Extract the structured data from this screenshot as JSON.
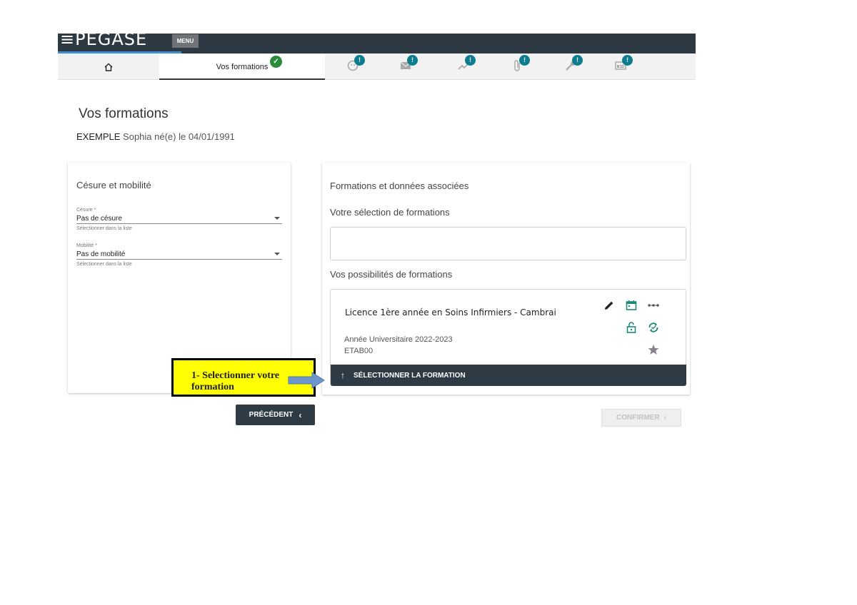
{
  "header": {
    "logo": "≡PEGASE",
    "menu_label": "MENU"
  },
  "tabs": {
    "active_label": "Vos formations",
    "badge_mark": "!",
    "check_mark": "✓",
    "icons": [
      "home-icon",
      "face-icon",
      "mail-icon",
      "trend-icon",
      "paperclip-icon",
      "wrench-icon",
      "id-card-icon"
    ]
  },
  "page": {
    "title": "Vos formations",
    "lastname": "EXEMPLE",
    "person_rest": "Sophia né(e) le 04/01/1991"
  },
  "left_card": {
    "title": "Césure et mobilité",
    "cesure": {
      "label": "Césure *",
      "value": "Pas de césure",
      "hint": "Sélectionner dans la liste"
    },
    "mobilite": {
      "label": "Mobilité *",
      "value": "Pas de mobilité",
      "hint": "Sélectionner dans la liste"
    }
  },
  "right_card": {
    "title": "Formations et données associées",
    "selection_title": "Votre sélection de formations",
    "possibilities_title": "Vos possibilités de formations",
    "formation": {
      "name": "Licence 1ère année en Soins Infirmiers - Cambrai",
      "year": "Année Universitaire 2022-2023",
      "etab": "ETAB00",
      "select_label": "SÉLECTIONNER LA FORMATION"
    }
  },
  "buttons": {
    "previous": "PRÉCÉDENT",
    "confirm": "CONFIRMER"
  },
  "annotation": {
    "line1": "1- Selectionner votre",
    "line2": "formation"
  },
  "colors": {
    "header": "#2d3a44",
    "badge": "#0c7d8e",
    "check": "#2a8c3a",
    "accent_icon": "#1c8a7a",
    "callout": "#ffff00"
  }
}
